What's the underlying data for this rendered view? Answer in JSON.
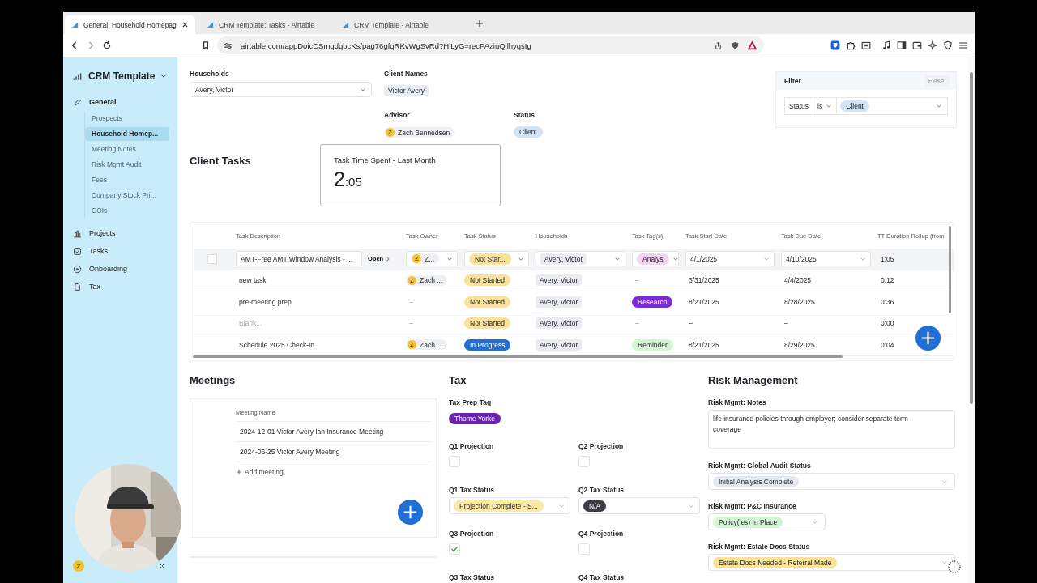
{
  "browser": {
    "tabs": [
      {
        "title": "General: Household Homepag",
        "selected": true
      },
      {
        "title": "CRM Template: Tasks - Airtable",
        "selected": false
      },
      {
        "title": "CRM Template - Airtable",
        "selected": false
      }
    ],
    "url": "airtable.com/appDoicCSmqdqbcKs/pag76gfqRKvWgSvRd?HlLyG=recPAziuQllhyqsIg"
  },
  "sidebar": {
    "title": "CRM Template",
    "sections": [
      {
        "label": "General",
        "children": [
          {
            "label": "Prospects",
            "selected": false
          },
          {
            "label": "Household Homep...",
            "selected": true
          },
          {
            "label": "Meeting Notes",
            "selected": false
          },
          {
            "label": "Risk Mgmt Audit",
            "selected": false
          },
          {
            "label": "Fees",
            "selected": false
          },
          {
            "label": "Company Stock Pri...",
            "selected": false
          },
          {
            "label": "COIs",
            "selected": false
          }
        ]
      },
      {
        "label": "Projects"
      },
      {
        "label": "Tasks"
      },
      {
        "label": "Onboarding"
      },
      {
        "label": "Tax"
      }
    ],
    "user_initial": "Z"
  },
  "record": {
    "households": {
      "label": "Households",
      "value": "Avery, Victor"
    },
    "client_names": {
      "label": "Client Names",
      "value": "Victor Avery"
    },
    "advisor": {
      "label": "Advisor",
      "initial": "Z",
      "name": "Zach Bennedsen"
    },
    "status": {
      "label": "Status",
      "value": "Client"
    }
  },
  "filter": {
    "title": "Filter",
    "reset": "Reset",
    "field": "Status",
    "operator": "is",
    "value": "Client"
  },
  "client_tasks": {
    "heading": "Client Tasks",
    "metric": {
      "title": "Task Time Spent - Last Month",
      "value_main": "2",
      "value_minor": ":05"
    },
    "table": {
      "columns": [
        "Task Description",
        "Task Owner",
        "Task Status",
        "Households",
        "Task Tag(s)",
        "Task Start Date",
        "Task Due Date",
        "TT Duration Rollup (from"
      ],
      "rows": [
        {
          "selected": true,
          "description": "AMT-Free AMT Window Analysis - ...",
          "open": "Open",
          "owner": {
            "initial": "Z",
            "name": "Z..."
          },
          "status": {
            "label": "Not Star...",
            "color": "#fbe29a"
          },
          "household": "Avery, Victor",
          "tag": {
            "label": "Analys",
            "color": "#f5d3f3"
          },
          "start": "4/1/2025",
          "due": "4/10/2025",
          "duration": "1:05"
        },
        {
          "selected": false,
          "description": "new task",
          "owner": {
            "initial": "Z",
            "name": "Zach ..."
          },
          "status": {
            "label": "Not Started",
            "color": "#fbe29a"
          },
          "household": "Avery, Victor",
          "tag": "–",
          "start": "3/31/2025",
          "due": "4/4/2025",
          "duration": "0:12"
        },
        {
          "selected": false,
          "description": "pre-meeting prep",
          "owner": "–",
          "status": {
            "label": "Not Started",
            "color": "#fbe29a"
          },
          "household": "Avery, Victor",
          "tag": {
            "label": "Research",
            "color": "#7c2bd4"
          },
          "start": "8/21/2025",
          "due": "8/28/2025",
          "duration": "0:36"
        },
        {
          "selected": false,
          "placeholder": "Blank...",
          "owner": "–",
          "status": {
            "label": "Not Started",
            "color": "#fbe29a"
          },
          "household": "Avery, Victor",
          "tag": "–",
          "start": "–",
          "due": "–",
          "duration": "0:00"
        },
        {
          "selected": false,
          "description": "Schedule 2025 Check-In",
          "owner": {
            "initial": "Z",
            "name": "Zach ..."
          },
          "status": {
            "label": "In Progress",
            "color": "#1f6fd6"
          },
          "household": "Avery, Victor",
          "tag": {
            "label": "Reminder",
            "color": "#d3f5d6"
          },
          "start": "8/21/2025",
          "due": "8/29/2025",
          "duration": "0:04"
        }
      ]
    }
  },
  "meetings": {
    "heading": "Meetings",
    "column": "Meeting Name",
    "rows": [
      "2024-12-01 Victor Avery Ian Insurance Meeting",
      "2024-06-25 Victor Avery Meeting"
    ],
    "add": "Add meeting"
  },
  "tax": {
    "heading": "Tax",
    "prep_tag": {
      "label": "Tax Prep Tag",
      "value": "Thome Yorke",
      "color": "#6a23b0"
    },
    "fields": [
      {
        "kind": "checkbox",
        "label": "Q1 Projection",
        "checked": false
      },
      {
        "kind": "checkbox",
        "label": "Q2 Projection",
        "checked": false
      },
      {
        "kind": "select",
        "label": "Q1 Tax Status",
        "value": "Projection Complete - S...",
        "color": "#fbe9a8"
      },
      {
        "kind": "select",
        "label": "Q2 Tax Status",
        "value": "N/A",
        "color": "#3a3d42"
      },
      {
        "kind": "checkbox",
        "label": "Q3 Projection",
        "checked": true
      },
      {
        "kind": "checkbox",
        "label": "Q4 Projection",
        "checked": false
      },
      {
        "kind": "select",
        "label": "Q3 Tax Status"
      },
      {
        "kind": "select",
        "label": "Q4 Tax Status"
      }
    ]
  },
  "risk": {
    "heading": "Risk Management",
    "notes": {
      "label": "Risk Mgmt: Notes",
      "value": "life insurance policies through employer; consider separate term coverage"
    },
    "fields": [
      {
        "label": "Risk Mgmt: Global Audit Status",
        "value": "Initial Analysis Complete",
        "color": "#e3e8ef"
      },
      {
        "label": "Risk Mgmt: P&C Insurance",
        "value": "Policy(ies) In Place",
        "color": "#d3f5d6"
      },
      {
        "label": "Risk Mgmt: Estate Docs Status",
        "value": "Estate Docs Needed - Referral Made",
        "color": "#fbe29a"
      }
    ]
  }
}
